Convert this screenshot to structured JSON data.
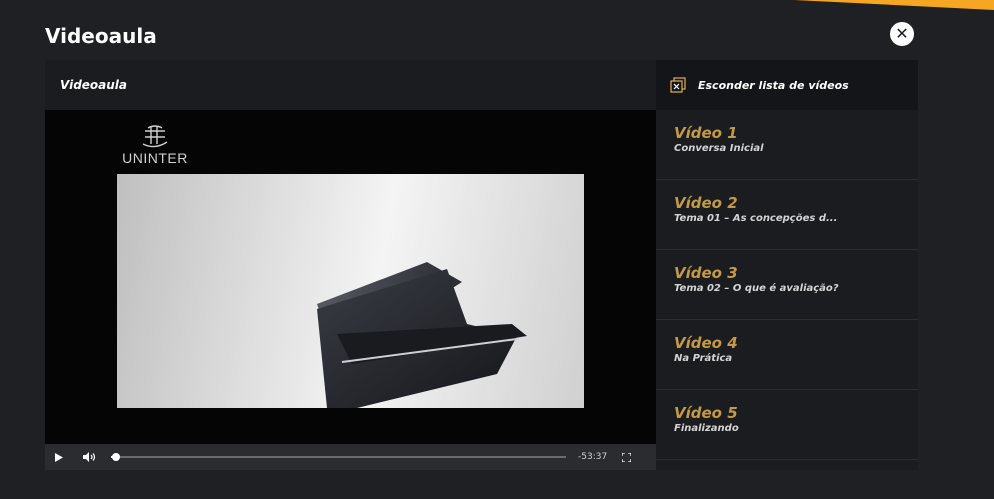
{
  "page": {
    "title": "Videoaula"
  },
  "player": {
    "header_label": "Videoaula",
    "logo_text": "UNINTER",
    "time_remaining": "-53:37",
    "progress": 0.01
  },
  "sidebar": {
    "toggle_label": "Esconder lista de vídeos",
    "items": [
      {
        "num": "Vídeo 1",
        "desc": "Conversa Inicial"
      },
      {
        "num": "Vídeo 2",
        "desc": "Tema 01 – As concepções d..."
      },
      {
        "num": "Vídeo 3",
        "desc": "Tema 02 – O que é avaliação?"
      },
      {
        "num": "Vídeo 4",
        "desc": "Na Prática"
      },
      {
        "num": "Vídeo 5",
        "desc": "Finalizando"
      }
    ]
  },
  "colors": {
    "background": "#1f2023",
    "accent_orange": "#f5a623",
    "video_number": "#c39a45"
  },
  "icons": {
    "close": "close-circle-icon",
    "play": "play-icon",
    "volume": "volume-icon",
    "fullscreen": "fullscreen-icon",
    "hide_list": "hide-list-icon"
  }
}
